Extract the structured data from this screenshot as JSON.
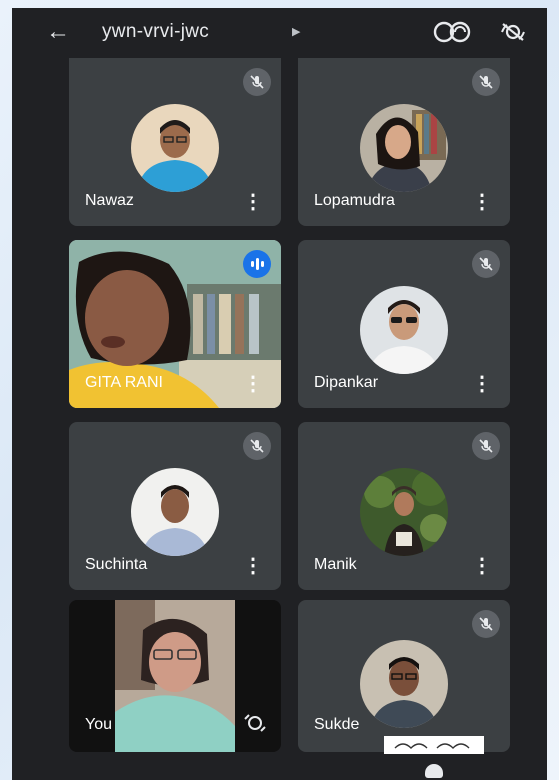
{
  "header": {
    "meeting_code": "ywn-vrvi-jwc",
    "back_icon": "arrow-left-icon",
    "caret_icon": "caret-right-icon",
    "camera_switch_icon": "camera-switch-icon",
    "audio_icon": "audio-output-icon"
  },
  "participants": [
    {
      "name": "Nawaz",
      "muted": true
    },
    {
      "name": "Lopamudra",
      "muted": true
    },
    {
      "name": "GITA RANI",
      "muted": false,
      "speaking": true
    },
    {
      "name": "Dipankar",
      "muted": true
    },
    {
      "name": "Suchinta",
      "muted": true
    },
    {
      "name": "Manik",
      "muted": true
    },
    {
      "name": "You",
      "muted": false
    },
    {
      "name": "Sukde",
      "muted": true
    }
  ],
  "colors": {
    "background": "#202124",
    "tile": "#3c4043",
    "mute_badge": "#5f6368",
    "speaking_badge": "#1a73e8"
  }
}
